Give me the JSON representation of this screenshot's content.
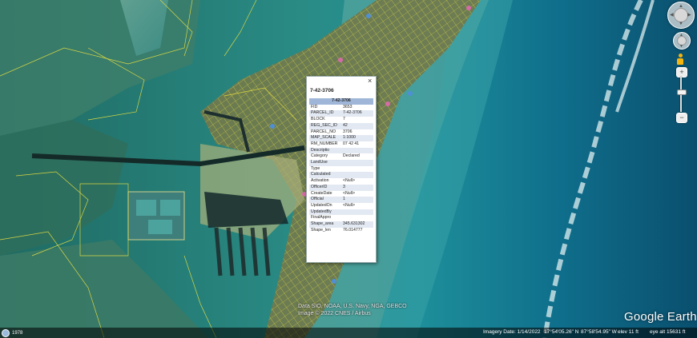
{
  "popup": {
    "title": "7-42-3706",
    "close_glyph": "×",
    "header": "7-42-3706",
    "rows": [
      {
        "k": "FID",
        "v": "3653"
      },
      {
        "k": "PARCEL_ID",
        "v": "7-42-3706"
      },
      {
        "k": "BLOCK",
        "v": "7"
      },
      {
        "k": "REG_SEC_ID",
        "v": "42"
      },
      {
        "k": "PARCEL_NO",
        "v": "3706"
      },
      {
        "k": "MAP_SCALE",
        "v": "1:1000"
      },
      {
        "k": "RM_NUMBER",
        "v": "07 42 41"
      },
      {
        "k": "Descriptio",
        "v": ""
      },
      {
        "k": "Category",
        "v": "Declared"
      },
      {
        "k": "LandUse",
        "v": ""
      },
      {
        "k": "Type",
        "v": ""
      },
      {
        "k": "Calculated",
        "v": ""
      },
      {
        "k": "Activation",
        "v": "<Null>"
      },
      {
        "k": "OfficerID",
        "v": "3"
      },
      {
        "k": "CreateDate",
        "v": "<Null>"
      },
      {
        "k": "Official",
        "v": "1"
      },
      {
        "k": "UpdatedOn",
        "v": "<Null>"
      },
      {
        "k": "UpdatedBy",
        "v": ""
      },
      {
        "k": "FinalAppro",
        "v": ""
      },
      {
        "k": "Shape_area",
        "v": "345.631302"
      },
      {
        "k": "Shape_len",
        "v": "76.014777"
      }
    ]
  },
  "map": {
    "attribution_1": "Data SIO, NOAA, U.S. Navy, NGA, GEBCO",
    "attribution_2": "Image © 2022 CNES / Airbus",
    "brand": "Google Earth"
  },
  "status_bar": {
    "scale_label": "1978",
    "imagery_date": "Imagery Date: 1/14/2022",
    "lat": "17°54'05.26\" N",
    "lon": "87°58'54.95\" W",
    "elev": "elev   11 ft",
    "eye_alt": "eye alt  15631 ft"
  },
  "controls": {
    "look_icon": "look-joystick-icon",
    "move_icon": "move-joystick-icon",
    "pegman_icon": "street-view-pegman-icon",
    "zoom_in_glyph": "+",
    "zoom_out_glyph": "−",
    "zoom_level": 0.6
  },
  "colors": {
    "parcel_lines": "#e8e040",
    "deep_sea": "#0c5d7a",
    "popup_header": "#9fb6d8"
  }
}
